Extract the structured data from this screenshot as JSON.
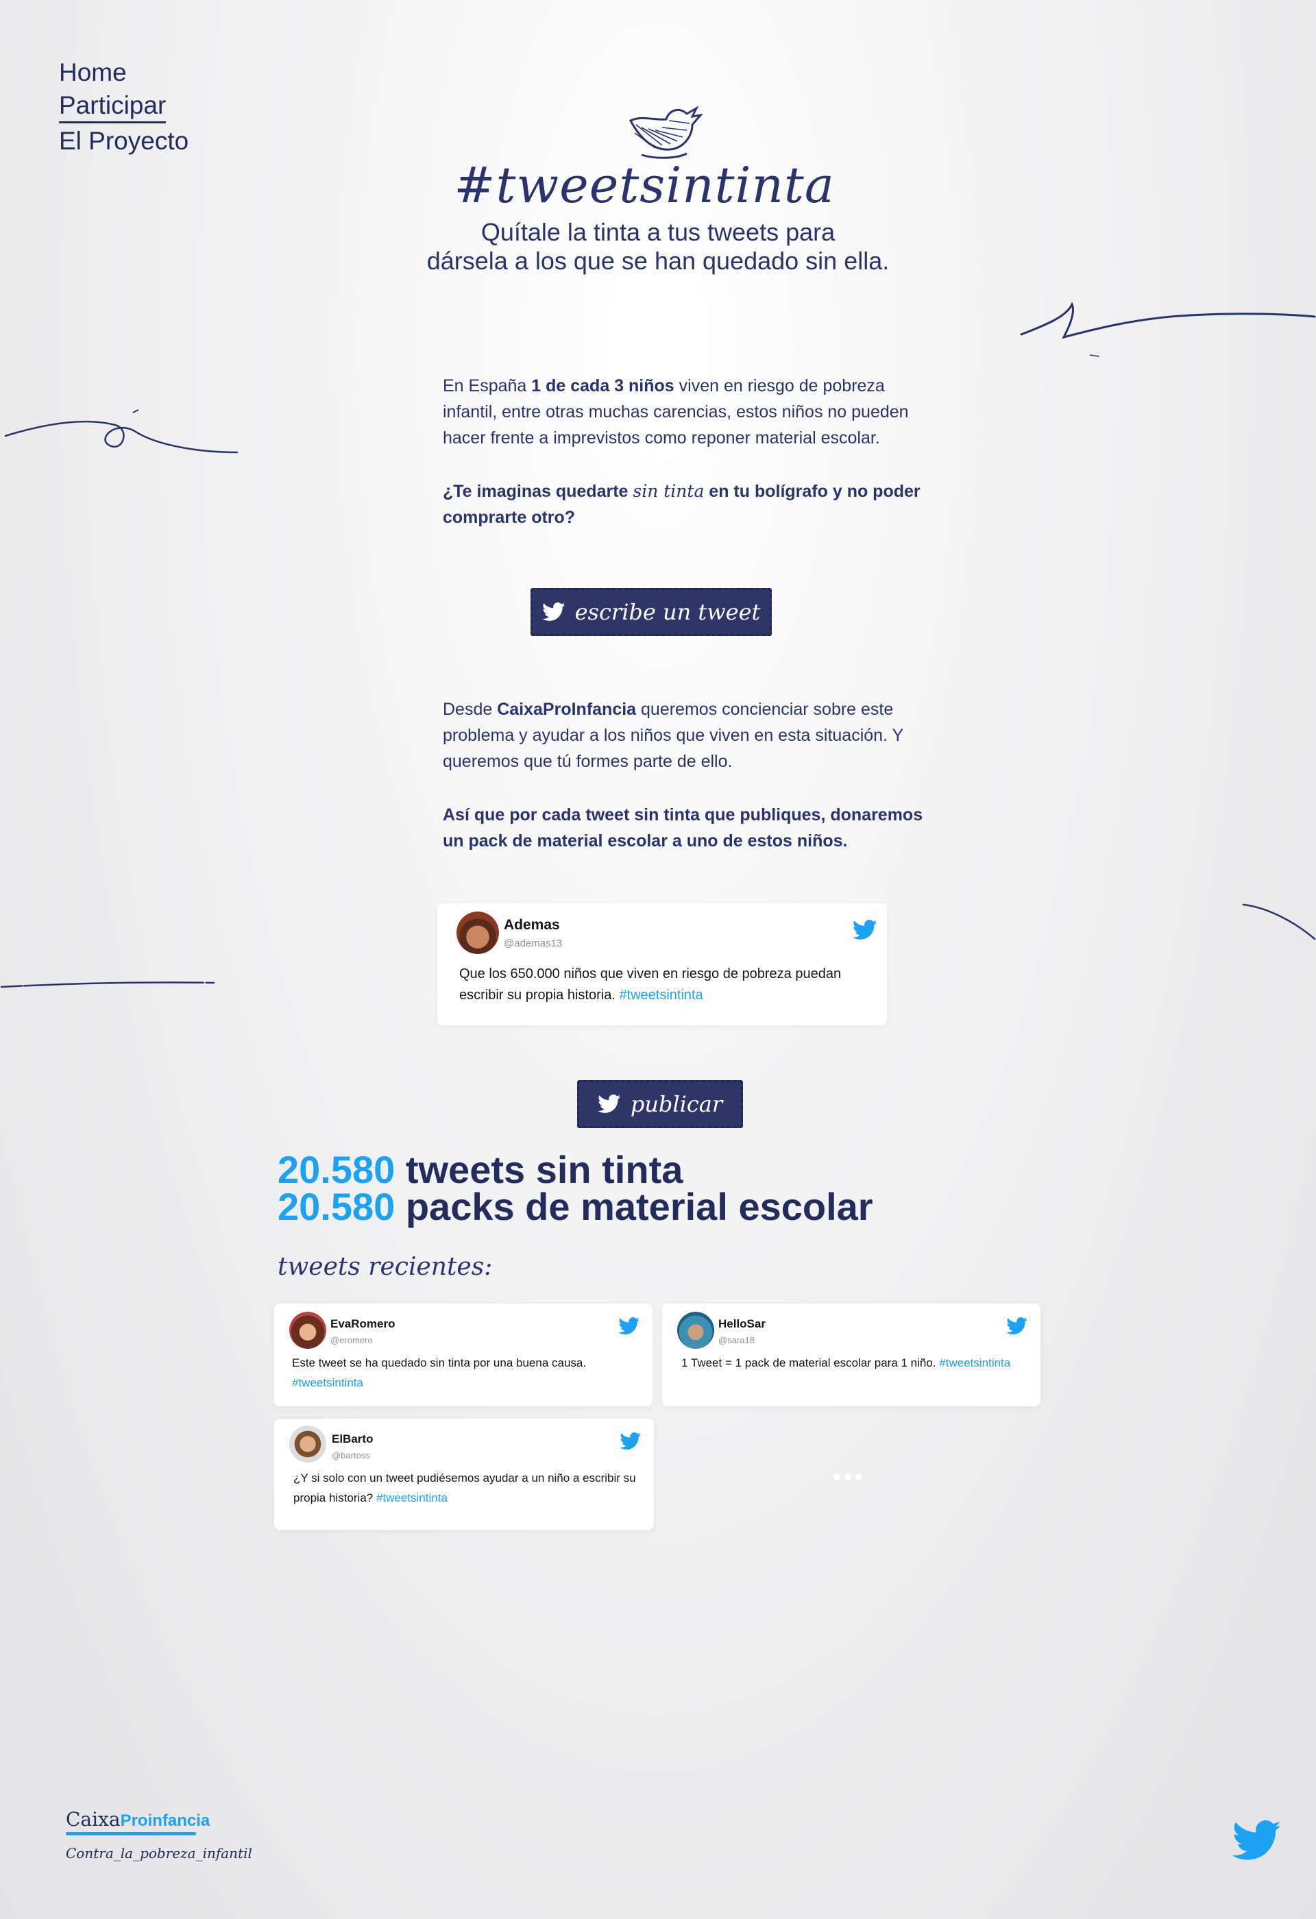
{
  "nav": {
    "items": [
      {
        "label": "Home"
      },
      {
        "label": "Participar",
        "active": true
      },
      {
        "label": "El Proyecto"
      }
    ]
  },
  "hero": {
    "hashtag": "#tweetsintinta",
    "tagline_line1": "Quítale la tinta a tus tweets para",
    "tagline_line2": "dársela a los que se han quedado sin ella."
  },
  "intro": {
    "p1_pre": "En España ",
    "p1_bold": "1 de cada 3 niños",
    "p1_post": " viven en riesgo de pobreza infantil, entre otras muchas carencias, estos niños no pueden hacer frente a imprevistos como reponer material escolar.",
    "q_pre": "¿Te imaginas quedarte ",
    "q_script": "sin tinta",
    "q_post": " en tu bolígrafo y no poder comprarte otro?"
  },
  "write_button": "escribe un tweet",
  "mission": {
    "p_pre": "Desde ",
    "p_bold": "CaixaProInfancia",
    "p_post": " queremos concienciar sobre este problema y ayudar a los niños que viven en esta situación. Y queremos que tú formes parte de ello.",
    "pledge": "Así que por cada tweet sin tinta que publiques, donaremos un pack de material escolar a uno de estos niños."
  },
  "preview_tweet": {
    "name": "Ademas",
    "handle": "@ademas13",
    "text": "Que los 650.000 niños que viven en riesgo de pobreza puedan escribir su propia historia. ",
    "hashtag": "#tweetsintinta"
  },
  "publish_button": "publicar",
  "stats": {
    "tweets_count": "20.580",
    "tweets_label": " tweets sin tinta",
    "packs_count": "20.580",
    "packs_label": " packs de material escolar"
  },
  "recent_label": "tweets recientes:",
  "recent_tweets": [
    {
      "name": "EvaRomero",
      "handle": "@eromero",
      "text": "Este tweet se ha quedado sin tinta por una buena causa. ",
      "hashtag": "#tweetsintinta"
    },
    {
      "name": "HelloSar",
      "handle": "@sara18",
      "text": "1 Tweet = 1 pack de material escolar para 1 niño. ",
      "hashtag": "#tweetsintinta"
    },
    {
      "name": "ElBarto",
      "handle": "@bartoss",
      "text": "¿Y si solo con un tweet pudiésemos ayudar a un niño a escribir su propia historia? ",
      "hashtag": "#tweetsintinta"
    }
  ],
  "footer": {
    "brand_pre": "Caixa",
    "brand_post": "Proinfancia",
    "slogan": "Contra_la_pobreza_infantil"
  },
  "colors": {
    "navy": "#232d5c",
    "twitter_blue": "#1da1f2",
    "stamp": "#2f3566"
  },
  "icons": [
    "twitter-bird-icon",
    "sketch-bird-icon",
    "more-dots-icon"
  ]
}
